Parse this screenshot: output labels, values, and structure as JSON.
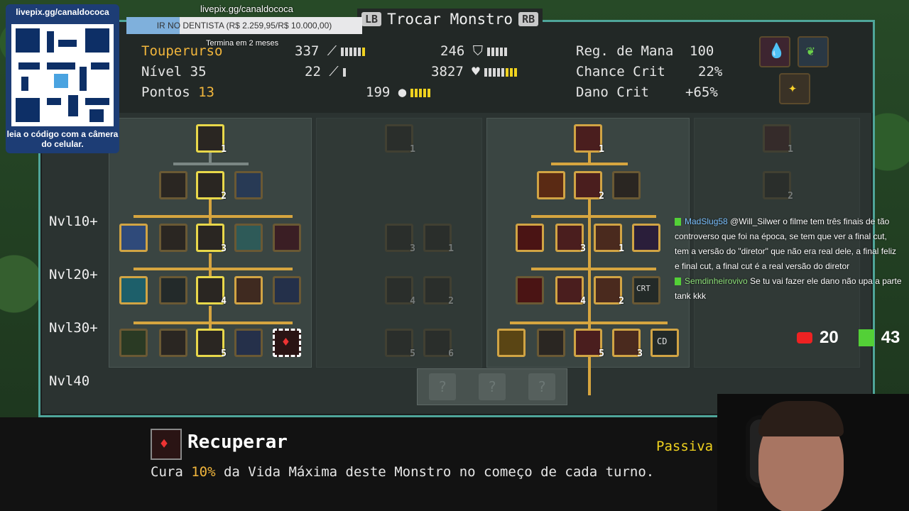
{
  "stream": {
    "qr_label": "livepix.gg/canaldococa",
    "qr_caption": "leia o código com a câmera do celular.",
    "goal_url": "livepix.gg/canaldococa",
    "goal_text": "IR NO DENTISTA (R$ 2.259,95/R$ 10.000,00)",
    "goal_sub": "Termina em 2 meses",
    "goal_progress_pct": 22.6,
    "youtube_count": "20",
    "kick_count": "43",
    "chat": [
      {
        "user": "MadSlug58",
        "text": "@Will_Silwer o filme tem três finais de tão controverso que foi na época, se tem que ver a final cut, tem a versão do \"diretor\" que não era real dele, a final feliz e final cut, a final cut é a real versão do diretor"
      },
      {
        "user": "Semdinheirovivo",
        "text": "Se tu vai fazer ele dano não upa a parte tank kkk"
      }
    ]
  },
  "header": {
    "lb": "LB",
    "rb": "RB",
    "title": "Trocar Monstro",
    "monster_name": "Touperurso",
    "level_label": "Nível 35",
    "points_label": "Pontos",
    "points_value": "13",
    "attack": "337",
    "magic": "22",
    "defense": "246",
    "hp": "3827",
    "speed": "199",
    "mana_regen_label": "Reg. de Mana",
    "mana_regen": "100",
    "crit_chance_label": "Chance Crit",
    "crit_chance": "22%",
    "crit_dmg_label": "Dano Crit",
    "crit_dmg": "+65%"
  },
  "levels": [
    "Nvl10+",
    "Nvl20+",
    "Nvl30+",
    "Nvl40"
  ],
  "tree1": {
    "root": "1",
    "row1": "2",
    "row2": "3",
    "row3": "4",
    "row4": "5"
  },
  "tree3": {
    "root": "1",
    "r1": "2",
    "r2a": "3",
    "r2b": "1",
    "r3a": "4",
    "r3b": "2",
    "r4a": "5",
    "r4b": "3",
    "crt": "CRT",
    "cd": "CD"
  },
  "tree2": {
    "a": "3",
    "b": "1",
    "c": "4",
    "d": "2",
    "e": "5",
    "f": "6",
    "root": "1"
  },
  "tree4": {
    "root": "1",
    "a": "2"
  },
  "unknown": [
    "?",
    "?",
    "?"
  ],
  "skill": {
    "name": "Recuperar",
    "type": "Passiva",
    "desc_pre": "Cura ",
    "desc_pct": "10%",
    "desc_post": " da Vida Máxima deste Monstro no começo de cada turno."
  }
}
